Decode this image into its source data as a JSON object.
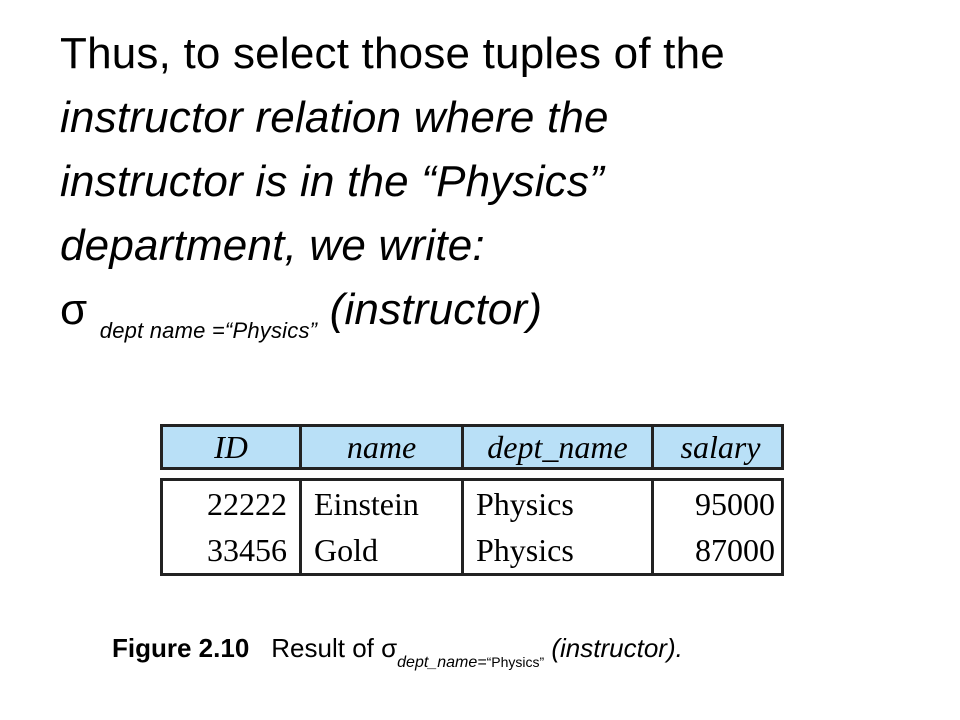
{
  "slide": {
    "line1": "Thus, to select those tuples of the",
    "line2": "instructor relation where the",
    "line3": "instructor is in the “Physics”",
    "line4": "department, we write:",
    "sigma": "σ",
    "subscript": "dept name =“Physics”",
    "argument": "(instructor)"
  },
  "table": {
    "columns": [
      "ID",
      "name",
      "dept_name",
      "salary"
    ],
    "rows": [
      [
        "22222",
        "Einstein",
        "Physics",
        "95000"
      ],
      [
        "33456",
        "Gold",
        "Physics",
        "87000"
      ]
    ]
  },
  "caption": {
    "label": "Figure 2.10",
    "text": "Result of σ",
    "subscript": "dept_name=",
    "subscript_value": "“Physics”",
    "argument": "(instructor).",
    "colors": {
      "header_bg": "#b9e0f7"
    }
  }
}
